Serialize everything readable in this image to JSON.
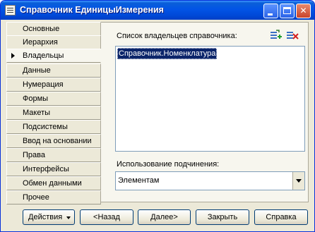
{
  "window": {
    "title": "Справочник ЕдиницыИзмерения"
  },
  "tabs": [
    {
      "label": "Основные"
    },
    {
      "label": "Иерархия"
    },
    {
      "label": "Владельцы",
      "active": true
    },
    {
      "label": "Данные"
    },
    {
      "label": "Нумерация"
    },
    {
      "label": "Формы"
    },
    {
      "label": "Макеты"
    },
    {
      "label": "Подсистемы"
    },
    {
      "label": "Ввод на основании"
    },
    {
      "label": "Права"
    },
    {
      "label": "Интерфейсы"
    },
    {
      "label": "Обмен данными"
    },
    {
      "label": "Прочее"
    }
  ],
  "owners": {
    "label": "Список владельцев справочника:",
    "items": [
      "Справочник.Номенклатура"
    ],
    "add_icon": "add-owner-icon",
    "delete_icon": "delete-owner-icon"
  },
  "usage": {
    "label": "Использование подчинения:",
    "value": "Элементам"
  },
  "buttons": {
    "actions": "Действия",
    "back": "<Назад",
    "next": "Далее>",
    "close": "Закрыть",
    "help": "Справка"
  },
  "colors": {
    "titlebar": "#0254e6",
    "selection": "#0a246a",
    "panel": "#f7f6ee",
    "window": "#ece9d8"
  }
}
